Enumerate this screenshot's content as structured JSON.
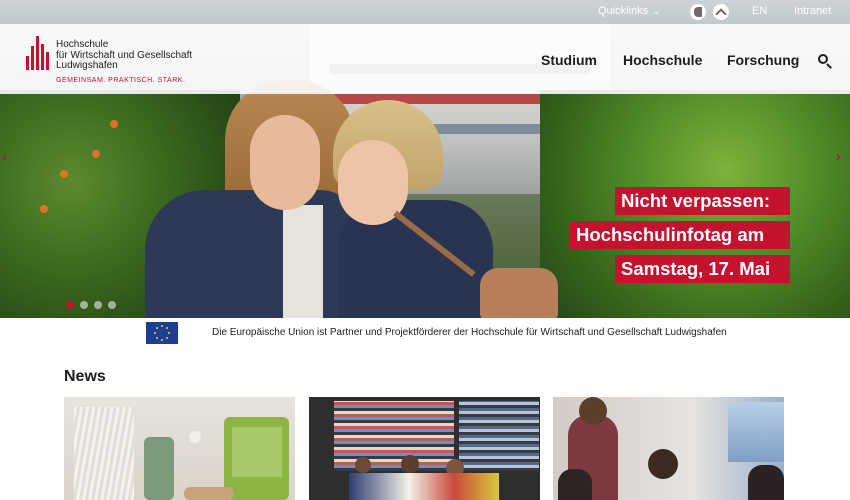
{
  "topbar": {
    "quicklinks_label": "Quicklinks",
    "language_label": "EN",
    "intranet_label": "Intranet",
    "icons": [
      "contrast-icon",
      "accessibility-icon"
    ]
  },
  "header": {
    "logo": {
      "name_line1": "Hochschule",
      "name_line2": "für Wirtschaft und Gesellschaft",
      "name_line3": "Ludwigshafen",
      "claim": "GEMEINSAM. PRAKTISCH. STARK."
    },
    "nav": [
      "Studium",
      "Hochschule",
      "Forschung"
    ],
    "search_icon": "search-icon"
  },
  "hero": {
    "headline_lines": [
      "Nicht verpassen:",
      "Hochschulinfotag am",
      "Samstag, 17. Mai"
    ],
    "slides_count": 4,
    "active_slide": 1,
    "accent_color": "#c4122f"
  },
  "eu_notice": {
    "text": "Die Europäische Union ist Partner und Projektförderer der Hochschule für Wirtschaft und Gesellschaft Ludwigshafen"
  },
  "news": {
    "title": "News"
  }
}
